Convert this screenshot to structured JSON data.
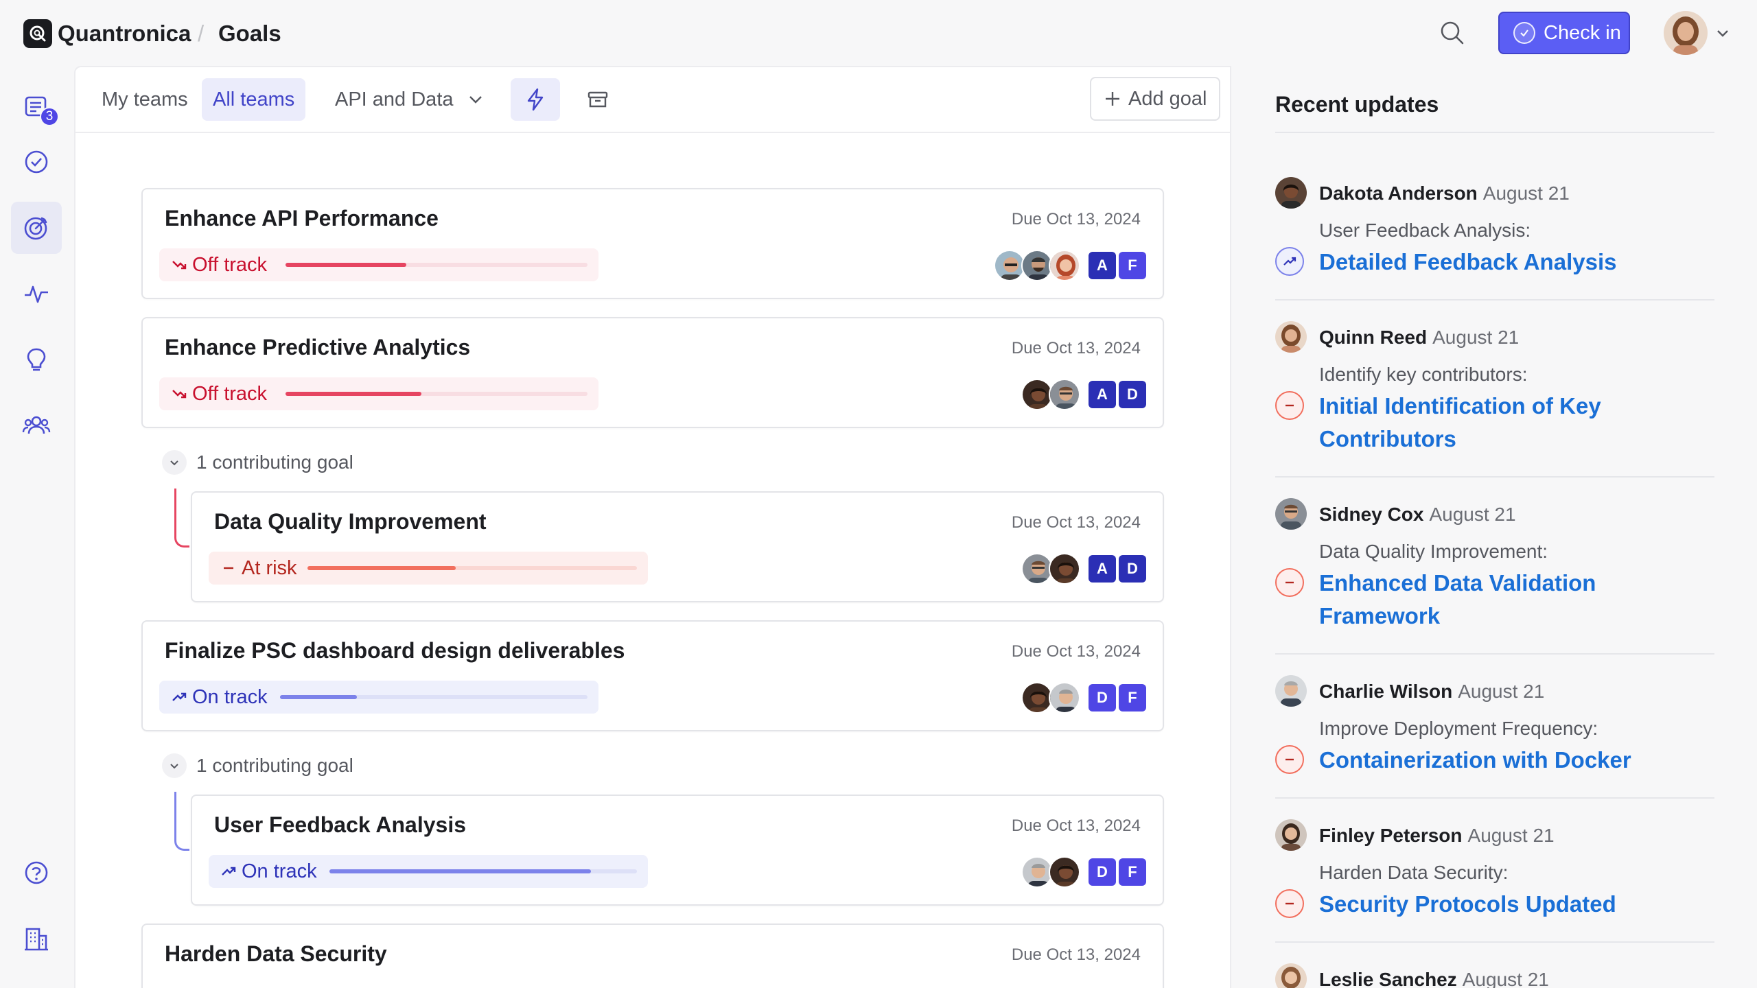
{
  "header": {
    "brand": "Quantronica",
    "separator": "/",
    "crumb": "Goals",
    "checkin_label": "Check in"
  },
  "rail": {
    "inbox_badge": "3"
  },
  "toolbar": {
    "tabs": [
      {
        "label": "My teams",
        "active": false
      },
      {
        "label": "All teams",
        "active": true
      },
      {
        "label": "API and Data",
        "active": false
      }
    ],
    "add_goal_label": "Add goal"
  },
  "goals": [
    {
      "title": "Enhance API Performance",
      "due": "Due Oct 13, 2024",
      "status": "Off track",
      "status_type": "off",
      "progress": 0.4,
      "avatars": [
        "bald-man",
        "man-beard",
        "woman-red"
      ],
      "initials": [
        "A",
        "F"
      ]
    },
    {
      "title": "Enhance Predictive Analytics",
      "due": "Due Oct 13, 2024",
      "status": "Off track",
      "status_type": "off",
      "progress": 0.45,
      "avatars": [
        "woman-dark",
        "man-glasses"
      ],
      "initials": [
        "A",
        "D"
      ]
    },
    {
      "title": "Data Quality Improvement",
      "due": "Due Oct 13, 2024",
      "status": "At risk",
      "status_type": "risk",
      "progress": 0.45,
      "avatars": [
        "man-glasses",
        "woman-dark"
      ],
      "initials": [
        "A",
        "D"
      ]
    },
    {
      "title": "Finalize PSC dashboard design deliverables",
      "due": "Due Oct 13, 2024",
      "status": "On track",
      "status_type": "on",
      "progress": 0.25,
      "avatars": [
        "woman-dark",
        "man-grey"
      ],
      "initials": [
        "D",
        "F"
      ]
    },
    {
      "title": "User Feedback Analysis",
      "due": "Due Oct 13, 2024",
      "status": "On track",
      "status_type": "on",
      "progress": 0.85,
      "avatars": [
        "man-grey",
        "woman-dark"
      ],
      "initials": [
        "D",
        "F"
      ]
    },
    {
      "title": "Harden Data Security",
      "due": "Due Oct 13, 2024"
    }
  ],
  "contributing": [
    {
      "label": "1 contributing goal"
    },
    {
      "label": "1 contributing goal"
    }
  ],
  "updates": {
    "title": "Recent updates",
    "items": [
      {
        "name": "Dakota Anderson",
        "date": "August 21",
        "goal": "User Feedback Analysis:",
        "link": "Detailed Feedback Analysis",
        "icon": "on-track-icon"
      },
      {
        "name": "Quinn Reed",
        "date": "August 21",
        "goal": "Identify key contributors:",
        "link": "Initial Identification of Key Contributors",
        "icon": "at-risk-icon"
      },
      {
        "name": "Sidney Cox",
        "date": "August 21",
        "goal": "Data Quality Improvement:",
        "link": "Enhanced Data Validation Framework",
        "icon": "at-risk-icon"
      },
      {
        "name": "Charlie Wilson",
        "date": "August 21",
        "goal": "Improve Deployment Frequency:",
        "link": "Containerization with Docker",
        "icon": "at-risk-icon"
      },
      {
        "name": "Finley Peterson",
        "date": "August 21",
        "goal": "Harden Data Security:",
        "link": "Security Protocols Updated",
        "icon": "at-risk-icon"
      },
      {
        "name": "Leslie Sanchez",
        "date": "August 21"
      }
    ]
  },
  "colors": {
    "accent": "#5b5ef4",
    "off_track": "#c8102e",
    "at_risk": "#b3261e",
    "on_track": "#2e33b8",
    "link": "#1a6fd6",
    "initial_dark": "#2b2fb5",
    "initial_light": "#4f46e5"
  }
}
